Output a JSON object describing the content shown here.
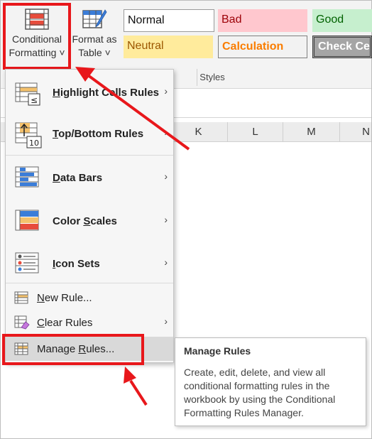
{
  "ribbon": {
    "conditional_formatting": {
      "line1": "Conditional",
      "line2": "Formatting",
      "chevron": "˅"
    },
    "format_as_table": {
      "line1": "Format as",
      "line2": "Table",
      "chevron": "˅"
    },
    "styles": {
      "normal": "Normal",
      "bad": "Bad",
      "good": "Good",
      "neutral": "Neutral",
      "calculation": "Calculation",
      "check_cell": "Check Ce"
    },
    "group_label": "Styles"
  },
  "sheet": {
    "columns": [
      "K",
      "L",
      "M",
      "N"
    ]
  },
  "menu": {
    "items": [
      {
        "pre": "",
        "key": "H",
        "post": "ighlight Cells Rules",
        "icon": "highlight-cells-rules-icon",
        "submenu": true
      },
      {
        "pre": "",
        "key": "T",
        "post": "op/Bottom Rules",
        "icon": "top-bottom-rules-icon",
        "submenu": true
      },
      {
        "pre": "",
        "key": "D",
        "post": "ata Bars",
        "icon": "data-bars-icon",
        "submenu": true
      },
      {
        "pre": "Color ",
        "key": "S",
        "post": "cales",
        "icon": "color-scales-icon",
        "submenu": true
      },
      {
        "pre": "",
        "key": "I",
        "post": "con Sets",
        "icon": "icon-sets-icon",
        "submenu": true
      }
    ],
    "small_items": [
      {
        "pre": "",
        "key": "N",
        "post": "ew Rule...",
        "icon": "new-rule-icon",
        "submenu": false
      },
      {
        "pre": "",
        "key": "C",
        "post": "lear Rules",
        "icon": "clear-rules-icon",
        "submenu": true
      },
      {
        "pre": "Manage ",
        "key": "R",
        "post": "ules...",
        "icon": "manage-rules-icon",
        "submenu": false
      }
    ],
    "arrow_glyph": "›"
  },
  "tooltip": {
    "title": "Manage Rules",
    "body": "Create, edit, delete, and view all conditional formatting rules in the workbook by using the Conditional Formatting Rules Manager."
  },
  "colors": {
    "annotation_red": "#e8171b",
    "menu_hover": "#d9d9d9",
    "excel_red": "#e74c3c",
    "excel_blue": "#3b7dd8"
  }
}
